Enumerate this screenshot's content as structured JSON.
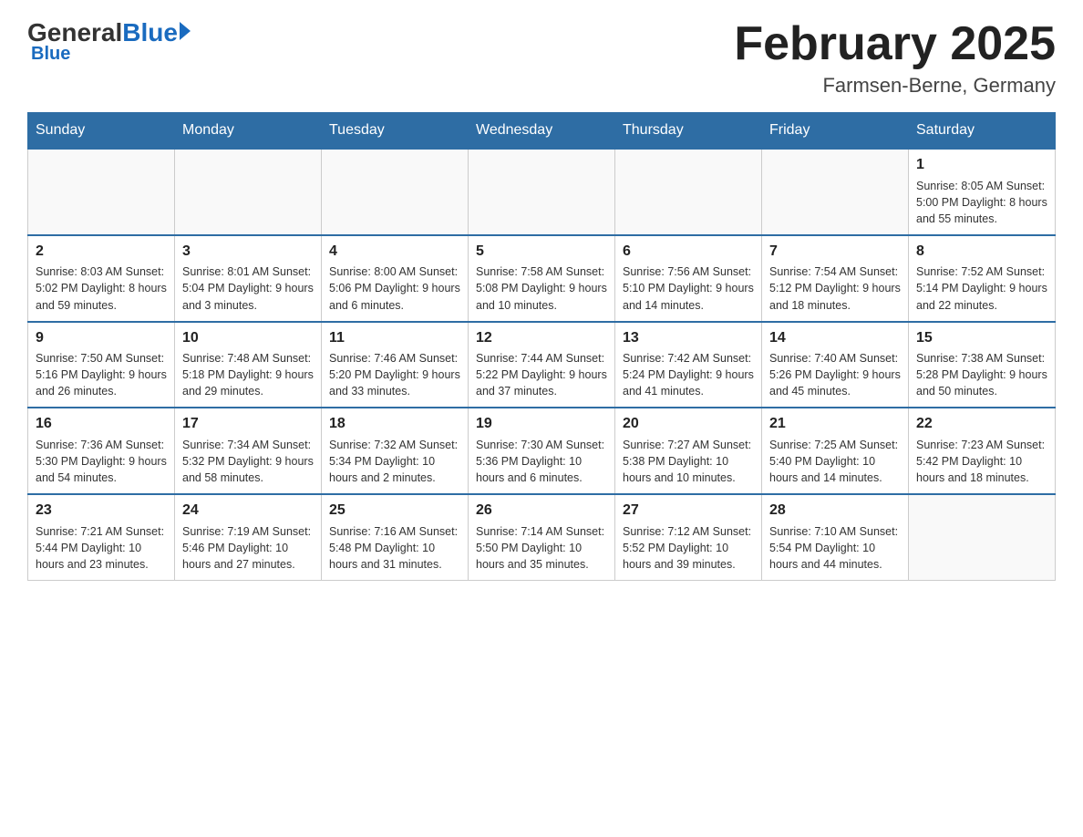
{
  "header": {
    "logo_general": "General",
    "logo_blue": "Blue",
    "month_title": "February 2025",
    "location": "Farmsen-Berne, Germany"
  },
  "days_of_week": [
    "Sunday",
    "Monday",
    "Tuesday",
    "Wednesday",
    "Thursday",
    "Friday",
    "Saturday"
  ],
  "weeks": [
    [
      {
        "day": "",
        "info": ""
      },
      {
        "day": "",
        "info": ""
      },
      {
        "day": "",
        "info": ""
      },
      {
        "day": "",
        "info": ""
      },
      {
        "day": "",
        "info": ""
      },
      {
        "day": "",
        "info": ""
      },
      {
        "day": "1",
        "info": "Sunrise: 8:05 AM\nSunset: 5:00 PM\nDaylight: 8 hours and 55 minutes."
      }
    ],
    [
      {
        "day": "2",
        "info": "Sunrise: 8:03 AM\nSunset: 5:02 PM\nDaylight: 8 hours and 59 minutes."
      },
      {
        "day": "3",
        "info": "Sunrise: 8:01 AM\nSunset: 5:04 PM\nDaylight: 9 hours and 3 minutes."
      },
      {
        "day": "4",
        "info": "Sunrise: 8:00 AM\nSunset: 5:06 PM\nDaylight: 9 hours and 6 minutes."
      },
      {
        "day": "5",
        "info": "Sunrise: 7:58 AM\nSunset: 5:08 PM\nDaylight: 9 hours and 10 minutes."
      },
      {
        "day": "6",
        "info": "Sunrise: 7:56 AM\nSunset: 5:10 PM\nDaylight: 9 hours and 14 minutes."
      },
      {
        "day": "7",
        "info": "Sunrise: 7:54 AM\nSunset: 5:12 PM\nDaylight: 9 hours and 18 minutes."
      },
      {
        "day": "8",
        "info": "Sunrise: 7:52 AM\nSunset: 5:14 PM\nDaylight: 9 hours and 22 minutes."
      }
    ],
    [
      {
        "day": "9",
        "info": "Sunrise: 7:50 AM\nSunset: 5:16 PM\nDaylight: 9 hours and 26 minutes."
      },
      {
        "day": "10",
        "info": "Sunrise: 7:48 AM\nSunset: 5:18 PM\nDaylight: 9 hours and 29 minutes."
      },
      {
        "day": "11",
        "info": "Sunrise: 7:46 AM\nSunset: 5:20 PM\nDaylight: 9 hours and 33 minutes."
      },
      {
        "day": "12",
        "info": "Sunrise: 7:44 AM\nSunset: 5:22 PM\nDaylight: 9 hours and 37 minutes."
      },
      {
        "day": "13",
        "info": "Sunrise: 7:42 AM\nSunset: 5:24 PM\nDaylight: 9 hours and 41 minutes."
      },
      {
        "day": "14",
        "info": "Sunrise: 7:40 AM\nSunset: 5:26 PM\nDaylight: 9 hours and 45 minutes."
      },
      {
        "day": "15",
        "info": "Sunrise: 7:38 AM\nSunset: 5:28 PM\nDaylight: 9 hours and 50 minutes."
      }
    ],
    [
      {
        "day": "16",
        "info": "Sunrise: 7:36 AM\nSunset: 5:30 PM\nDaylight: 9 hours and 54 minutes."
      },
      {
        "day": "17",
        "info": "Sunrise: 7:34 AM\nSunset: 5:32 PM\nDaylight: 9 hours and 58 minutes."
      },
      {
        "day": "18",
        "info": "Sunrise: 7:32 AM\nSunset: 5:34 PM\nDaylight: 10 hours and 2 minutes."
      },
      {
        "day": "19",
        "info": "Sunrise: 7:30 AM\nSunset: 5:36 PM\nDaylight: 10 hours and 6 minutes."
      },
      {
        "day": "20",
        "info": "Sunrise: 7:27 AM\nSunset: 5:38 PM\nDaylight: 10 hours and 10 minutes."
      },
      {
        "day": "21",
        "info": "Sunrise: 7:25 AM\nSunset: 5:40 PM\nDaylight: 10 hours and 14 minutes."
      },
      {
        "day": "22",
        "info": "Sunrise: 7:23 AM\nSunset: 5:42 PM\nDaylight: 10 hours and 18 minutes."
      }
    ],
    [
      {
        "day": "23",
        "info": "Sunrise: 7:21 AM\nSunset: 5:44 PM\nDaylight: 10 hours and 23 minutes."
      },
      {
        "day": "24",
        "info": "Sunrise: 7:19 AM\nSunset: 5:46 PM\nDaylight: 10 hours and 27 minutes."
      },
      {
        "day": "25",
        "info": "Sunrise: 7:16 AM\nSunset: 5:48 PM\nDaylight: 10 hours and 31 minutes."
      },
      {
        "day": "26",
        "info": "Sunrise: 7:14 AM\nSunset: 5:50 PM\nDaylight: 10 hours and 35 minutes."
      },
      {
        "day": "27",
        "info": "Sunrise: 7:12 AM\nSunset: 5:52 PM\nDaylight: 10 hours and 39 minutes."
      },
      {
        "day": "28",
        "info": "Sunrise: 7:10 AM\nSunset: 5:54 PM\nDaylight: 10 hours and 44 minutes."
      },
      {
        "day": "",
        "info": ""
      }
    ]
  ]
}
